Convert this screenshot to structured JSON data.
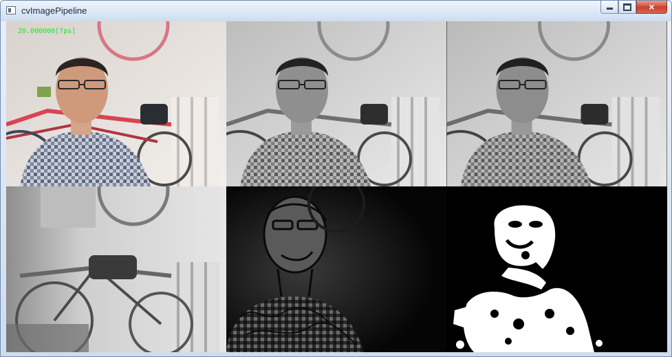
{
  "window": {
    "title": "cvImagePipeline",
    "controls": {
      "minimize": "minimize",
      "maximize": "maximize",
      "close": "×"
    }
  },
  "overlay": {
    "fps_text": "20.000000[fps]"
  },
  "panes": [
    {
      "id": "color-frame",
      "icon": "camera-frame"
    },
    {
      "id": "gray-frame",
      "icon": "grayscale-frame"
    },
    {
      "id": "gray-frame-2",
      "icon": "grayscale-frame"
    },
    {
      "id": "background-frame",
      "icon": "background-frame"
    },
    {
      "id": "difference-frame",
      "icon": "edge-frame"
    },
    {
      "id": "threshold-mask",
      "icon": "binary-mask"
    }
  ],
  "colors": {
    "fps_text": "#23e32a",
    "title_text": "#1c2a3d",
    "close_button": "#c9412b"
  }
}
